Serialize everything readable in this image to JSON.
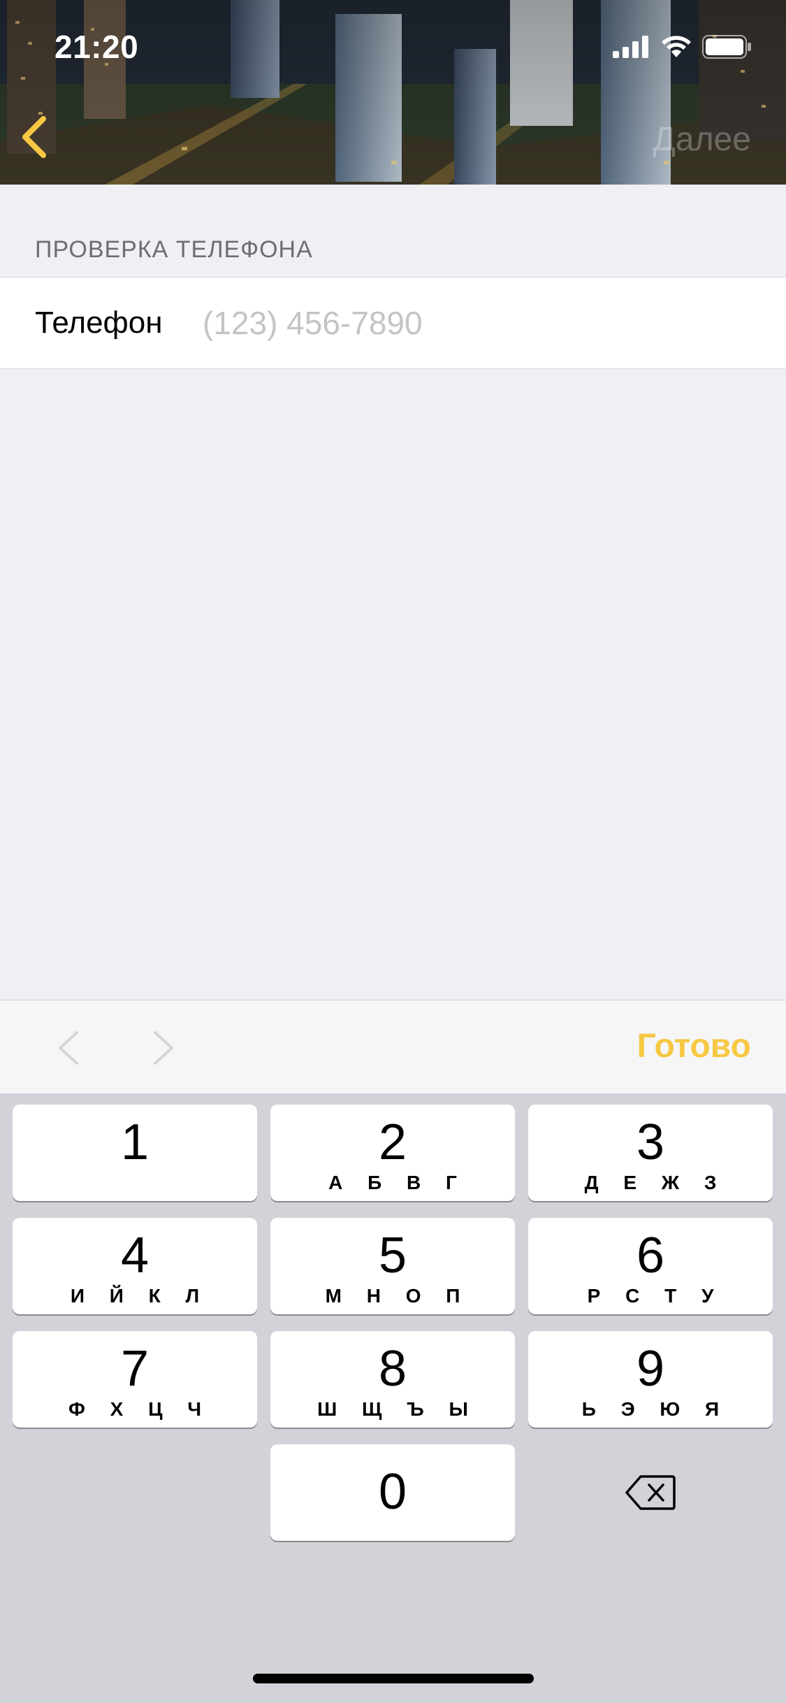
{
  "status_bar": {
    "time": "21:20",
    "signal_icon": "cellular-signal-icon",
    "wifi_icon": "wifi-icon",
    "battery_icon": "battery-icon"
  },
  "nav": {
    "back_icon": "chevron-left-icon",
    "next_label": "Далее"
  },
  "form": {
    "section_title": "ПРОВЕРКА ТЕЛЕФОНА",
    "phone_label": "Телефон",
    "phone_placeholder": "(123) 456-7890",
    "phone_value": ""
  },
  "toolbar": {
    "prev_icon": "chevron-left-icon",
    "next_icon": "chevron-right-icon",
    "done_label": "Готово"
  },
  "keypad": {
    "keys": [
      {
        "digit": "1",
        "letters": ""
      },
      {
        "digit": "2",
        "letters": "А Б В Г"
      },
      {
        "digit": "3",
        "letters": "Д Е Ж З"
      },
      {
        "digit": "4",
        "letters": "И Й К Л"
      },
      {
        "digit": "5",
        "letters": "М Н О П"
      },
      {
        "digit": "6",
        "letters": "Р С Т У"
      },
      {
        "digit": "7",
        "letters": "Ф Х Ц Ч"
      },
      {
        "digit": "8",
        "letters": "Ш Щ Ъ Ы"
      },
      {
        "digit": "9",
        "letters": "Ь Э Ю Я"
      },
      {
        "digit": "0",
        "letters": ""
      }
    ],
    "backspace_icon": "backspace-icon"
  },
  "colors": {
    "accent": "#f7c843",
    "background": "#efeff4",
    "keyboard": "#d1d3d9"
  }
}
